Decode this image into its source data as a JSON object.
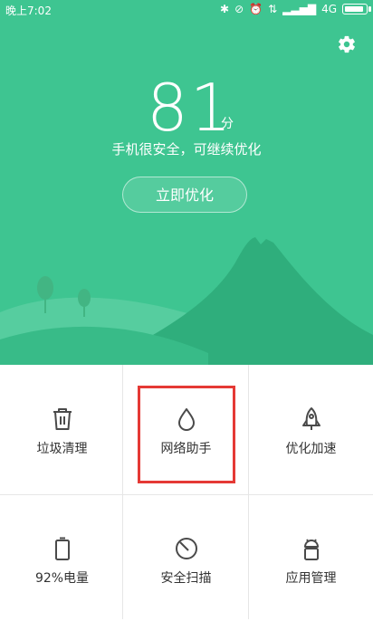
{
  "status_bar": {
    "time": "晚上7:02",
    "network": "4G",
    "battery_level": 0.92
  },
  "header": {
    "score": "81",
    "score_unit": "分",
    "subtitle": "手机很安全，可继续优化",
    "optimize_button": "立即优化"
  },
  "grid": {
    "items": [
      {
        "label": "垃圾清理",
        "icon": "trash-icon"
      },
      {
        "label": "网络助手",
        "icon": "droplet-icon"
      },
      {
        "label": "优化加速",
        "icon": "rocket-icon"
      },
      {
        "label": "92%电量",
        "icon": "battery-icon"
      },
      {
        "label": "安全扫描",
        "icon": "scan-icon"
      },
      {
        "label": "应用管理",
        "icon": "android-icon"
      }
    ]
  },
  "colors": {
    "primary": "#3ec591",
    "highlight": "#e53935",
    "text": "#333333"
  }
}
